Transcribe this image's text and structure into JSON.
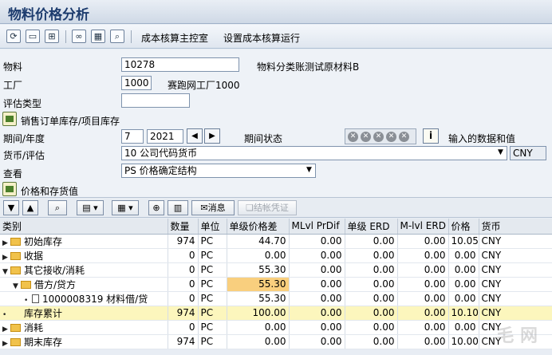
{
  "window": {
    "title": "物料价格分析"
  },
  "toolbar": {
    "icons": [
      "refresh-icon",
      "display-icon",
      "hierarchy-icon",
      "glasses-icon",
      "grid-icon",
      "search-icon"
    ],
    "cost_cockpit": "成本核算主控室",
    "set_run": "设置成本核算运行"
  },
  "form": {
    "material_label": "物料",
    "material_value": "10278",
    "material_desc": "物料分类账测试原材料B",
    "plant_label": "工厂",
    "plant_value": "1000",
    "plant_desc": "赛跑网工厂1000",
    "valuation_type_label": "评估类型",
    "valuation_type_value": "",
    "sales_order_section": "销售订单库存/项目库存",
    "period_label": "期间/年度",
    "period_value": "7",
    "year_value": "2021",
    "period_status_label": "期间状态",
    "entered_qty_label": "输入的数据和值",
    "currency_label": "货币/评估",
    "currency_value": "10 公司代码货币",
    "currency_code": "CNY",
    "view_label": "查看",
    "view_value": "PS 价格确定结构",
    "price_stock_section": "价格和存货值"
  },
  "gridbar": {
    "message_btn": "消息",
    "post_btn": "结帐凭证"
  },
  "table": {
    "headers": [
      "类别",
      "数量",
      "单位",
      "单级价格差",
      "MLvl PrDif",
      "单级 ERD",
      "M-lvl ERD",
      "价格",
      "货币"
    ],
    "rows": [
      {
        "name": "初始库存",
        "qty": "974",
        "unit": "PC",
        "sl": "44.70",
        "ml": "0.00",
        "erd": "0.00",
        "mlerd": "0.00",
        "price": "10.05",
        "cur": "CNY"
      },
      {
        "name": "收据",
        "qty": "0",
        "unit": "PC",
        "sl": "0.00",
        "ml": "0.00",
        "erd": "0.00",
        "mlerd": "0.00",
        "price": "0.00",
        "cur": "CNY"
      },
      {
        "name": "其它接收/消耗",
        "qty": "0",
        "unit": "PC",
        "sl": "55.30",
        "ml": "0.00",
        "erd": "0.00",
        "mlerd": "0.00",
        "price": "0.00",
        "cur": "CNY"
      },
      {
        "name": "借方/贷方",
        "qty": "0",
        "unit": "PC",
        "sl": "55.30",
        "ml": "0.00",
        "erd": "0.00",
        "mlerd": "0.00",
        "price": "0.00",
        "cur": "CNY"
      },
      {
        "name": "1000008319 材料借/贷",
        "qty": "0",
        "unit": "PC",
        "sl": "55.30",
        "ml": "0.00",
        "erd": "0.00",
        "mlerd": "0.00",
        "price": "0.00",
        "cur": "CNY"
      },
      {
        "name": "库存累计",
        "qty": "974",
        "unit": "PC",
        "sl": "100.00",
        "ml": "0.00",
        "erd": "0.00",
        "mlerd": "0.00",
        "price": "10.10",
        "cur": "CNY"
      },
      {
        "name": "消耗",
        "qty": "0",
        "unit": "PC",
        "sl": "0.00",
        "ml": "0.00",
        "erd": "0.00",
        "mlerd": "0.00",
        "price": "0.00",
        "cur": "CNY"
      },
      {
        "name": "期末库存",
        "qty": "974",
        "unit": "PC",
        "sl": "0.00",
        "ml": "0.00",
        "erd": "0.00",
        "mlerd": "0.00",
        "price": "10.00",
        "cur": "CNY"
      }
    ]
  },
  "watermark": "毛  网"
}
